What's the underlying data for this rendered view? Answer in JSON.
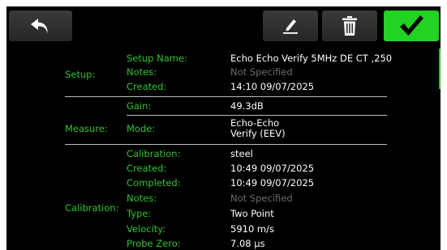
{
  "toolbar": {
    "back_icon": "undo-arrow-icon",
    "edit_icon": "pencil-edit-icon",
    "delete_icon": "trash-icon",
    "confirm_icon": "checkmark-icon",
    "confirm_color": "#22d322"
  },
  "setup": {
    "section_label": "Setup:",
    "name_label": "Setup Name:",
    "name_value": "Echo Echo Verify 5MHz DE CT ,250",
    "notes_label": "Notes:",
    "notes_value": "Not Specified",
    "created_label": "Created:",
    "created_value": "14:10 09/07/2025"
  },
  "measure": {
    "section_label": "Measure:",
    "gain_label": "Gain:",
    "gain_value": "49.3dB",
    "mode_label": "Mode:",
    "mode_value_line1": "Echo-Echo",
    "mode_value_line2": "Verify (EEV)"
  },
  "calibration": {
    "section_label": "Calibration:",
    "calibration_label": "Calibration:",
    "calibration_value": "steel",
    "created_label": "Created:",
    "created_value": "10:49 09/07/2025",
    "completed_label": "Completed:",
    "completed_value": "10:49 09/07/2025",
    "notes_label": "Notes:",
    "notes_value": "Not Specified",
    "type_label": "Type:",
    "type_value": "Two Point",
    "velocity_label": "Velocity:",
    "velocity_value": "5910 m/s",
    "probe_zero_label": "Probe Zero:",
    "probe_zero_value": "7.08 µs"
  },
  "colors": {
    "label_green": "#2fc52f",
    "value_white": "#ffffff",
    "muted_gray": "#6c6c6c",
    "background": "#000000"
  }
}
